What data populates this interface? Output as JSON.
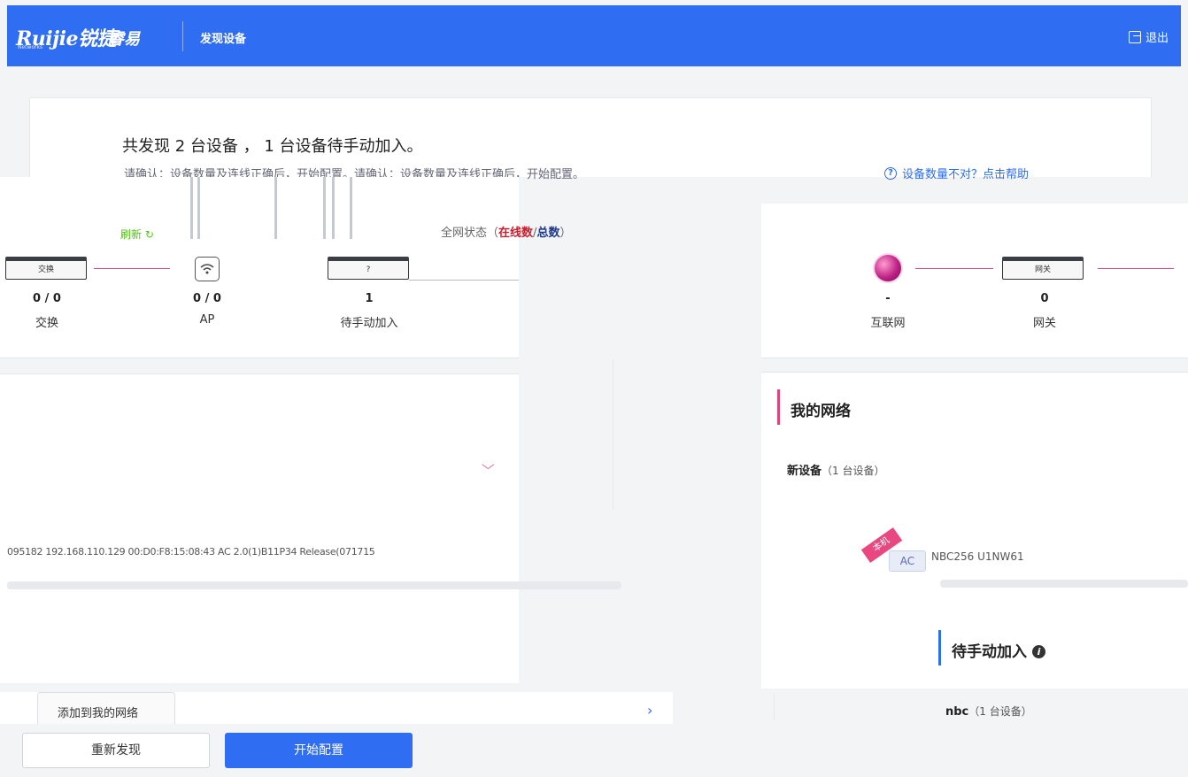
{
  "header": {
    "logo_en": "Ruijie",
    "logo_cn": "锐捷",
    "logo_sub": "Networks",
    "logo_brand": "睿易",
    "page_title": "发现设备",
    "logout_label": "退出"
  },
  "summary": {
    "title": "共发现 2 台设备 ， 1 台设备待手动加入。",
    "description": "请确认：设备数量及连线正确后，开始配置。请确认：设备数量及连线正确后，开始配置。",
    "help_link": "设备数量不对？点击帮助"
  },
  "refresh_label": "刷新 ↻",
  "network_status": {
    "prefix": "全网状态",
    "online": "在线数",
    "sep": "/",
    "total": "总数"
  },
  "topology_left": {
    "switch_box_label": "交换",
    "unknown_box_label": "?",
    "items": [
      {
        "count": "0 / 0",
        "label": "交换"
      },
      {
        "count": "0 / 0",
        "label": "AP"
      },
      {
        "count": "1",
        "label": "待手动加入"
      }
    ]
  },
  "topology_right": {
    "gateway_box_label": "网关",
    "items": [
      {
        "count": "-",
        "label": "互联网"
      },
      {
        "count": "0",
        "label": "网关"
      }
    ]
  },
  "device_row": {
    "text": "095182  192.168.110.129  00:D0:F8:15:08:43  AC  2.0(1)B11P34 Release(071715"
  },
  "my_network": {
    "title": "我的网络",
    "new_devices_label": "新设备",
    "new_devices_count": "（1 台设备）",
    "badge": "本机",
    "device_chip": "AC",
    "device_model": "NBC256  U1NW61"
  },
  "pending": {
    "title": "待手动加入",
    "group_name": "nbc",
    "group_count": "（1 台设备）"
  },
  "actions": {
    "add_to_network": "添加到我的网络",
    "rediscover": "重新发现",
    "start_config": "开始配置"
  },
  "colors": {
    "primary": "#2f6df2",
    "accent_pink": "#e0447a",
    "refresh_green": "#52c41a"
  }
}
